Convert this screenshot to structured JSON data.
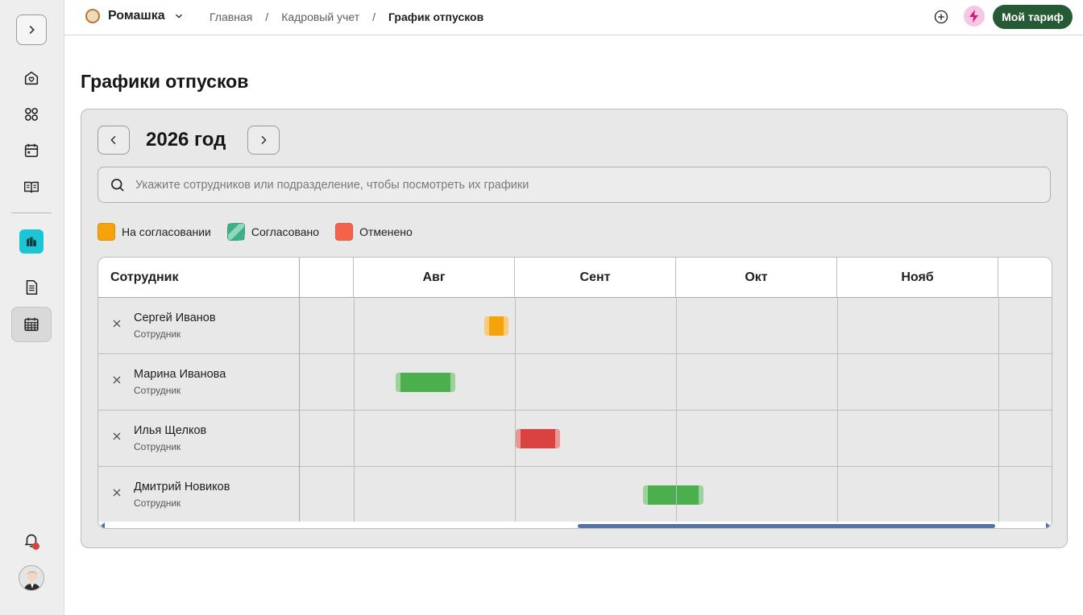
{
  "org": {
    "name": "Ромашка"
  },
  "breadcrumb": {
    "items": [
      "Главная",
      "Кадровый учет",
      "График отпусков"
    ]
  },
  "header": {
    "tariff_label": "Мой тариф"
  },
  "page": {
    "title": "Графики отпусков"
  },
  "year_nav": {
    "label": "2026 год"
  },
  "search": {
    "placeholder": "Укажите сотрудников или подразделение, чтобы посмотреть их графики"
  },
  "legend": [
    {
      "label": "На согласовании",
      "color": "#f5a20b"
    },
    {
      "label": "Согласовано",
      "color": "#43b28a"
    },
    {
      "label": "Отменено",
      "color": "#f3624a"
    }
  ],
  "table": {
    "employee_header": "Сотрудник",
    "months": [
      "",
      "Авг",
      "Сент",
      "Окт",
      "Нояб",
      ""
    ],
    "rows": [
      {
        "name": "Сергей Иванов",
        "role": "Сотрудник",
        "status": "pending",
        "color": "#f5a20b"
      },
      {
        "name": "Марина Иванова",
        "role": "Сотрудник",
        "status": "approved",
        "color": "#4caf4e"
      },
      {
        "name": "Илья Щелков",
        "role": "Сотрудник",
        "status": "cancelled",
        "color": "#d9423f"
      },
      {
        "name": "Дмитрий Новиков",
        "role": "Сотрудник",
        "status": "approved",
        "color": "#4caf4e"
      }
    ]
  },
  "icons": {
    "sidebar": [
      "chevron-right-icon",
      "home-icon",
      "apps-grid-icon",
      "calendar-icon",
      "book-icon",
      "team-app-icon",
      "document-icon",
      "calendar-grid-icon",
      "bell-icon",
      "avatar"
    ]
  }
}
